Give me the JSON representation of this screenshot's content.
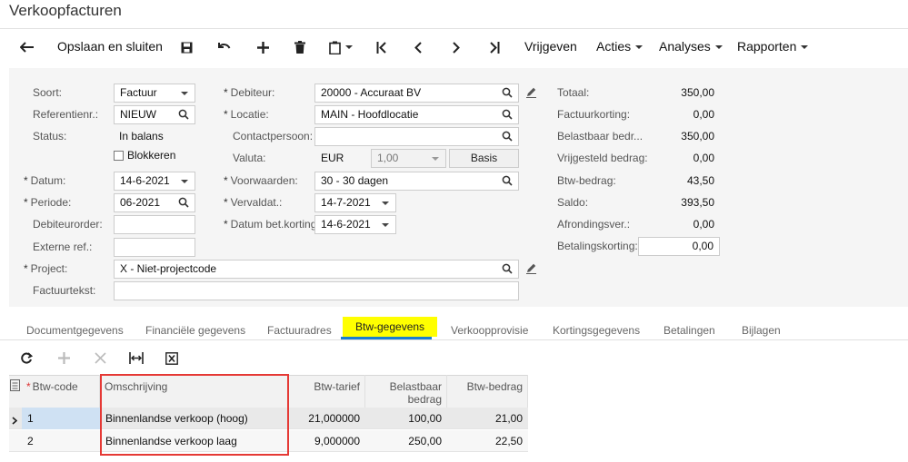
{
  "window": {
    "title": "Verkoopfacturen"
  },
  "toolbar": {
    "save_close": "Opslaan en sluiten",
    "release": "Vrijgeven",
    "actions": "Acties",
    "analyses": "Analyses",
    "reports": "Rapporten"
  },
  "form": {
    "soort": {
      "label": "Soort:",
      "value": "Factuur"
    },
    "referentienr": {
      "label": "Referentienr.:",
      "value": "NIEUW"
    },
    "status": {
      "label": "Status:",
      "value": "In balans"
    },
    "blokkeren": {
      "label": "Blokkeren",
      "checked": false
    },
    "datum": {
      "label": "Datum:",
      "value": "14-6-2021"
    },
    "periode": {
      "label": "Periode:",
      "value": "06-2021"
    },
    "debiteurorder": {
      "label": "Debiteurorder:",
      "value": ""
    },
    "externe_ref": {
      "label": "Externe ref.:",
      "value": ""
    },
    "project": {
      "label": "Project:",
      "value": "X - Niet-projectcode"
    },
    "factuurtekst": {
      "label": "Factuurtekst:",
      "value": ""
    },
    "debiteur": {
      "label": "Debiteur:",
      "value": "20000 - Accuraat BV"
    },
    "locatie": {
      "label": "Locatie:",
      "value": "MAIN - Hoofdlocatie"
    },
    "contactpersoon": {
      "label": "Contactpersoon:",
      "value": ""
    },
    "valuta": {
      "label": "Valuta:",
      "code": "EUR",
      "rate": "1,00",
      "basis_label": "Basis"
    },
    "voorwaarden": {
      "label": "Voorwaarden:",
      "value": "30 - 30 dagen"
    },
    "vervaldat": {
      "label": "Vervaldat.:",
      "value": "14-7-2021"
    },
    "datum_bet_korting": {
      "label": "Datum bet.korting:",
      "value": "14-6-2021"
    }
  },
  "totals": {
    "totaal": {
      "label": "Totaal:",
      "value": "350,00"
    },
    "factuurkorting": {
      "label": "Factuurkorting:",
      "value": "0,00"
    },
    "belastbaar": {
      "label": "Belastbaar bedr...",
      "value": "350,00"
    },
    "vrijgesteld": {
      "label": "Vrijgesteld bedrag:",
      "value": "0,00"
    },
    "btw_bedrag": {
      "label": "Btw-bedrag:",
      "value": "43,50"
    },
    "saldo": {
      "label": "Saldo:",
      "value": "393,50"
    },
    "afronding": {
      "label": "Afrondingsver.:",
      "value": "0,00"
    },
    "betalingskorting": {
      "label": "Betalingskorting:",
      "value": "0,00"
    }
  },
  "tabs": [
    "Documentgegevens",
    "Financiële gegevens",
    "Factuuradres",
    "Btw-gegevens",
    "Verkoopprovisie",
    "Kortingsgegevens",
    "Betalingen",
    "Bijlagen"
  ],
  "active_tab": "Btw-gegevens",
  "grid": {
    "columns": [
      "Btw-code",
      "Omschrijving",
      "Btw-tarief",
      "Belastbaar bedrag",
      "Btw-bedrag"
    ],
    "rows": [
      {
        "code": "1",
        "omschrijving": "Binnenlandse verkoop (hoog)",
        "tarief": "21,000000",
        "belastbaar": "100,00",
        "btw": "21,00",
        "selected": true
      },
      {
        "code": "2",
        "omschrijving": "Binnenlandse verkoop laag",
        "tarief": "9,000000",
        "belastbaar": "250,00",
        "btw": "22,50",
        "selected": false
      }
    ]
  },
  "colors": {
    "highlight": "#ffff00",
    "selected_row": "#d6e6f5",
    "annotation": "#e53935",
    "accent": "#1a7fd0"
  }
}
